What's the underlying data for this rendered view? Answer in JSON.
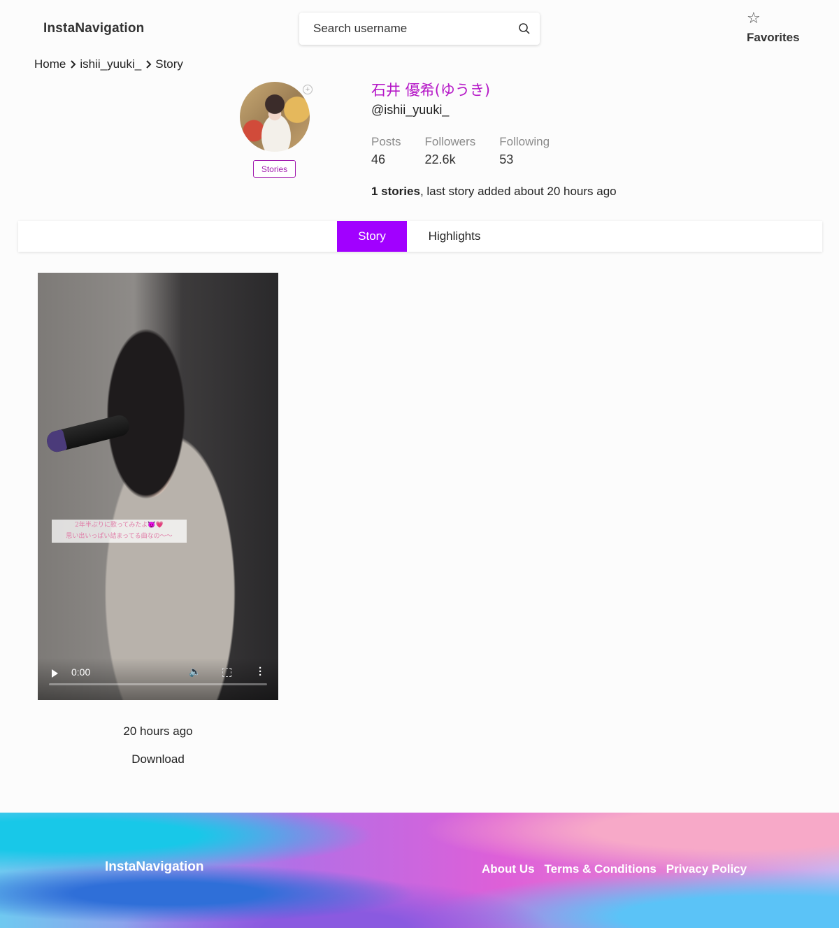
{
  "header": {
    "brand": "InstaNavigation",
    "search_placeholder": "Search username",
    "favorites_label": "Favorites"
  },
  "breadcrumb": [
    "Home",
    "ishii_yuuki_",
    "Story"
  ],
  "profile": {
    "display_name": "石井 優希(ゆうき)",
    "username": "@ishii_yuuki_",
    "stories_badge": "Stories",
    "stats": [
      {
        "label": "Posts",
        "value": "46"
      },
      {
        "label": "Followers",
        "value": "22.6k"
      },
      {
        "label": "Following",
        "value": "53"
      }
    ],
    "story_count": "1 stories",
    "story_summary": ", last story added about 20 hours ago"
  },
  "tabs": [
    {
      "label": "Story",
      "active": true
    },
    {
      "label": "Highlights",
      "active": false
    }
  ],
  "story": {
    "caption_line1": "2年半ぶりに歌ってみたよ😈💗",
    "caption_line2": "思い出いっぱい詰まってる曲なの〜〜",
    "video_time": "0:00",
    "posted": "20 hours ago",
    "download_label": "Download"
  },
  "footer": {
    "brand": "InstaNavigation",
    "links": [
      "About Us",
      "Terms & Conditions",
      "Privacy Policy"
    ]
  },
  "colors": {
    "accent": "#a100ff",
    "name": "#b517c7",
    "badge": "#a21caf"
  }
}
